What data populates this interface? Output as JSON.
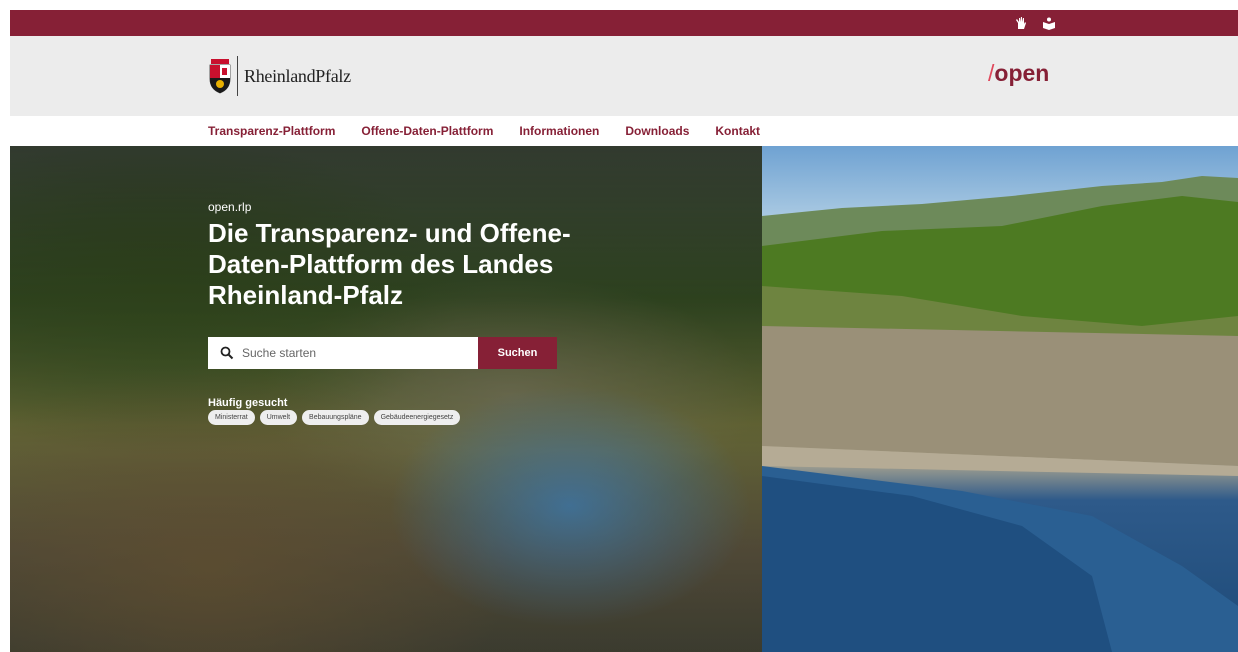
{
  "topbar": {
    "icons": [
      "sign-language-icon",
      "easy-read-icon"
    ]
  },
  "header": {
    "logo_text": "RheinlandPfalz",
    "brand_slash": "/",
    "brand_text": "open"
  },
  "nav": {
    "items": [
      {
        "label": "Transparenz-Plattform"
      },
      {
        "label": "Offene-Daten-Plattform"
      },
      {
        "label": "Informationen"
      },
      {
        "label": "Downloads"
      },
      {
        "label": "Kontakt"
      }
    ]
  },
  "hero": {
    "eyebrow": "open.rlp",
    "headline_lines": [
      "Die Transparenz- und Offene-",
      "Daten-Plattform des Landes",
      "Rheinland-Pfalz"
    ],
    "search": {
      "placeholder": "Suche starten",
      "button_label": "Suchen"
    },
    "frequent_label": "Häufig gesucht",
    "tags": [
      {
        "label": "Ministerrat"
      },
      {
        "label": "Umwelt"
      },
      {
        "label": "Bebauungspläne"
      },
      {
        "label": "Gebäudeenergiegesetz"
      }
    ]
  },
  "colors": {
    "brand": "#862036",
    "brand_accent": "#e0475b",
    "header_bg": "#ececec"
  }
}
